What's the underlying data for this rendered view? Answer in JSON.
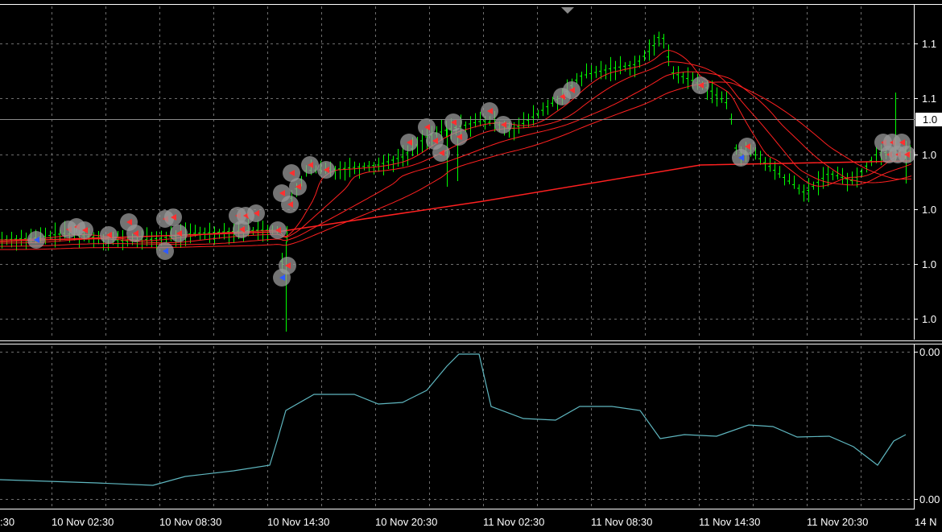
{
  "chart_data": [
    {
      "type": "candlestick",
      "panel": "price",
      "price_axis_labels": [
        "1.1",
        "1.1",
        "1.0",
        "1.0",
        "1.0",
        "1.0",
        "1.0"
      ],
      "current_price_label": "1.0",
      "time_labels": [
        ":30",
        "10 Nov 02:30",
        "10 Nov 08:30",
        "10 Nov 14:30",
        "10 Nov 20:30",
        "11 Nov 02:30",
        "11 Nov 08:30",
        "11 Nov 14:30",
        "11 Nov 20:30",
        "14 N"
      ],
      "grid": true,
      "colors": {
        "background": "#000000",
        "candle": "#00ff00",
        "ma": "#ff2020",
        "grid": "#6e6e6e",
        "buy_marker": "#2f5bff",
        "sell_marker": "#ff3030",
        "marker_halo": "#9a9a9a"
      }
    },
    {
      "type": "line",
      "panel": "indicator",
      "axis_labels": [
        "0.00",
        "0.00"
      ],
      "grid": true,
      "colors": {
        "line": "#5fb7c0"
      }
    }
  ]
}
